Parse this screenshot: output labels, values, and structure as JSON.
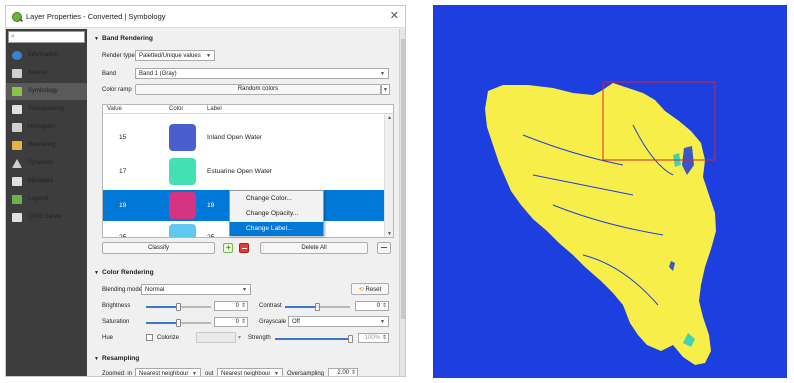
{
  "dialog": {
    "title": "Layer Properties - Converted | Symbology",
    "close_glyph": "✕"
  },
  "sidebar": {
    "search_glyph": "⌕",
    "items": [
      {
        "label": "Information",
        "icon": "info-icon",
        "color": "#3d7fd1"
      },
      {
        "label": "Source",
        "icon": "wrench-icon",
        "color": "#cfcfcf"
      },
      {
        "label": "Symbology",
        "icon": "brush-icon",
        "color": "#8bc34a"
      },
      {
        "label": "Transparency",
        "icon": "transparency-icon",
        "color": "#e0e0e0"
      },
      {
        "label": "Histogram",
        "icon": "histogram-icon",
        "color": "#d0d0d0"
      },
      {
        "label": "Rendering",
        "icon": "rendering-icon",
        "color": "#e3b341"
      },
      {
        "label": "Pyramids",
        "icon": "pyramid-icon",
        "color": "#cfcfcf"
      },
      {
        "label": "Metadata",
        "icon": "metadata-icon",
        "color": "#e0e0e0"
      },
      {
        "label": "Legend",
        "icon": "legend-icon",
        "color": "#6ab04c"
      },
      {
        "label": "QGIS Server",
        "icon": "server-icon",
        "color": "#e0e0e0"
      }
    ]
  },
  "band_rendering": {
    "header": "Band Rendering",
    "render_type_label": "Render type",
    "render_type_value": "Paletted/Unique values",
    "band_label": "Band",
    "band_value": "Band 1 (Gray)",
    "color_ramp_label": "Color ramp",
    "color_ramp_value": "Random colors",
    "columns": [
      "Value",
      "Color",
      "Label"
    ],
    "rows": [
      {
        "value": "15",
        "color": "#4a5fcf",
        "label": "Inland Open Water"
      },
      {
        "value": "17",
        "color": "#43e0b4",
        "label": "Estuarine Open Water"
      },
      {
        "value": "19",
        "color": "#d63384",
        "label": "19"
      },
      {
        "value": "25",
        "color": "#5fc7f0",
        "label": "25"
      }
    ],
    "context_menu": [
      "Change Color...",
      "Change Opacity...",
      "Change Label..."
    ],
    "classify_label": "Classify",
    "delete_all_label": "Delete All"
  },
  "color_rendering": {
    "header": "Color Rendering",
    "blending_mode_label": "Blending mode",
    "blending_mode_value": "Normal",
    "reset_label": "Reset",
    "brightness_label": "Brightness",
    "brightness_value": "0",
    "contrast_label": "Contrast",
    "contrast_value": "0",
    "saturation_label": "Saturation",
    "saturation_value": "0",
    "grayscale_label": "Grayscale",
    "grayscale_value": "Off",
    "hue_label": "Hue",
    "colorize_label": "Colorize",
    "strength_label": "Strength",
    "strength_value": "100%"
  },
  "resampling": {
    "header": "Resampling",
    "zoomed_in_label": "Zoomed: in",
    "zoomed_in_value": "Nearest neighbour",
    "zoomed_out_label": "out",
    "zoomed_out_value": "Nearest neighbour",
    "oversampling_label": "Oversampling",
    "oversampling_value": "2.00"
  },
  "map": {
    "background": "#1d3fe0",
    "land_color": "#f7ee4a",
    "extent_box_color": "#d8262a"
  }
}
